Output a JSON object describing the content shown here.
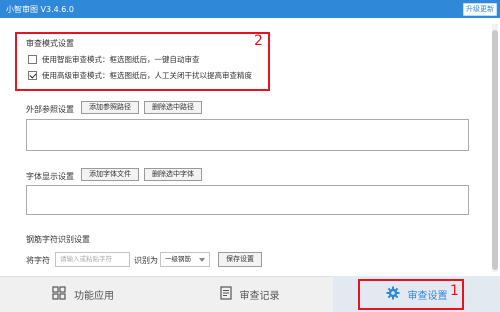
{
  "window": {
    "title": "小智审图 V3.4.6.0",
    "upgrade_label": "升级更新"
  },
  "review_mode": {
    "title": "审查模式设置",
    "options": [
      {
        "label": "使用智能审查模式：框选图纸后，一键自动审查",
        "checked": false
      },
      {
        "label": "使用高级审查模式：框选图纸后，人工关闭干扰以提高审查精度",
        "checked": true
      }
    ]
  },
  "external_ref": {
    "title": "外部参照设置",
    "add_label": "添加参照路径",
    "delete_label": "删除选中路径"
  },
  "font_display": {
    "title": "字体显示设置",
    "add_label": "添加字体文件",
    "delete_label": "删除选中字体"
  },
  "rebar": {
    "title": "钢筋字符识别设置",
    "char_label": "将字符",
    "char_placeholder": "请输入或粘贴字符",
    "identify_label": "识别为",
    "grade_value": "一级钢筋",
    "save_label": "保存设置"
  },
  "bottom_tabs": [
    {
      "label": "功能应用",
      "icon": "grid-icon"
    },
    {
      "label": "审查记录",
      "icon": "document-icon"
    },
    {
      "label": "审查设置",
      "icon": "gear-icon",
      "active": true
    }
  ],
  "annotations": {
    "marker_1": "1",
    "marker_2": "2"
  },
  "colors": {
    "accent": "#2f88d8",
    "highlight_red": "#e5141e"
  }
}
